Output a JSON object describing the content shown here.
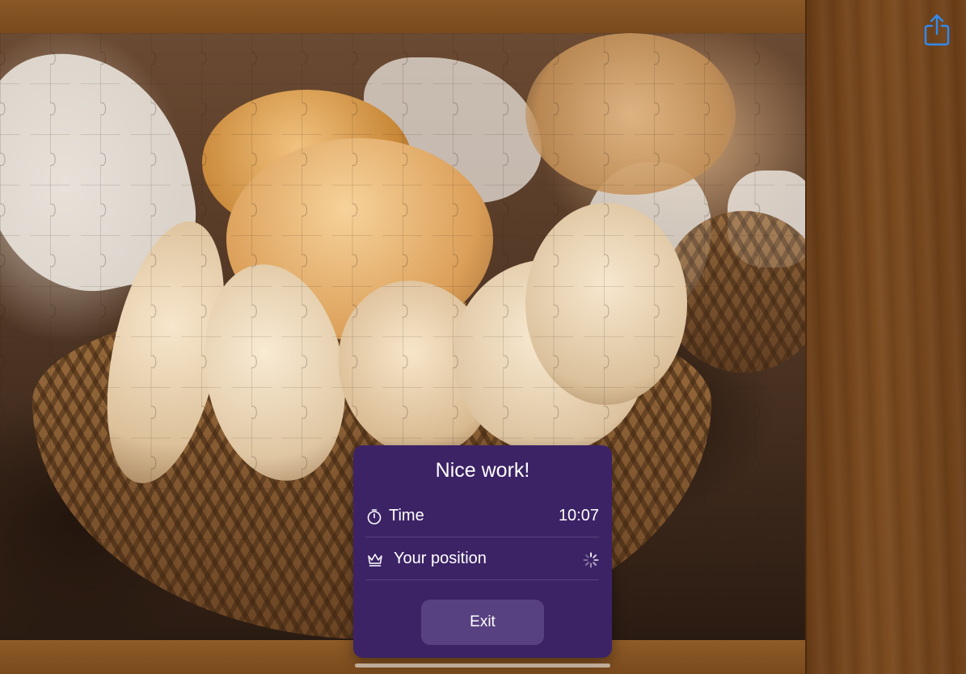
{
  "dialog": {
    "title": "Nice work!",
    "time_label": "Time",
    "time_value": "10:07",
    "position_label": "Your position",
    "position_status": "loading",
    "exit_label": "Exit"
  },
  "icons": {
    "share": "share-icon",
    "timer": "stopwatch-icon",
    "rank": "crown-icon",
    "loading": "spinner-icon"
  },
  "colors": {
    "dialog_background": "#3c2366",
    "exit_button": "#584181",
    "share_accent": "#2f8bf0"
  }
}
